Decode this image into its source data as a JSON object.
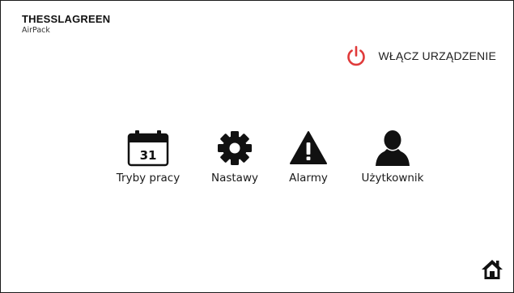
{
  "header": {
    "brand": "THESSLAGREEN",
    "model": "AirPack"
  },
  "power": {
    "label": "WŁĄCZ URZĄDZENIE",
    "icon": "power-icon",
    "color": "#e03a3a"
  },
  "menu": [
    {
      "label": "Tryby pracy",
      "icon": "calendar-icon",
      "calendar_day": "31"
    },
    {
      "label": "Nastawy",
      "icon": "gear-icon"
    },
    {
      "label": "Alarmy",
      "icon": "warning-icon"
    },
    {
      "label": "Użytkownik",
      "icon": "user-icon"
    }
  ],
  "footer": {
    "home_icon": "home-icon"
  }
}
